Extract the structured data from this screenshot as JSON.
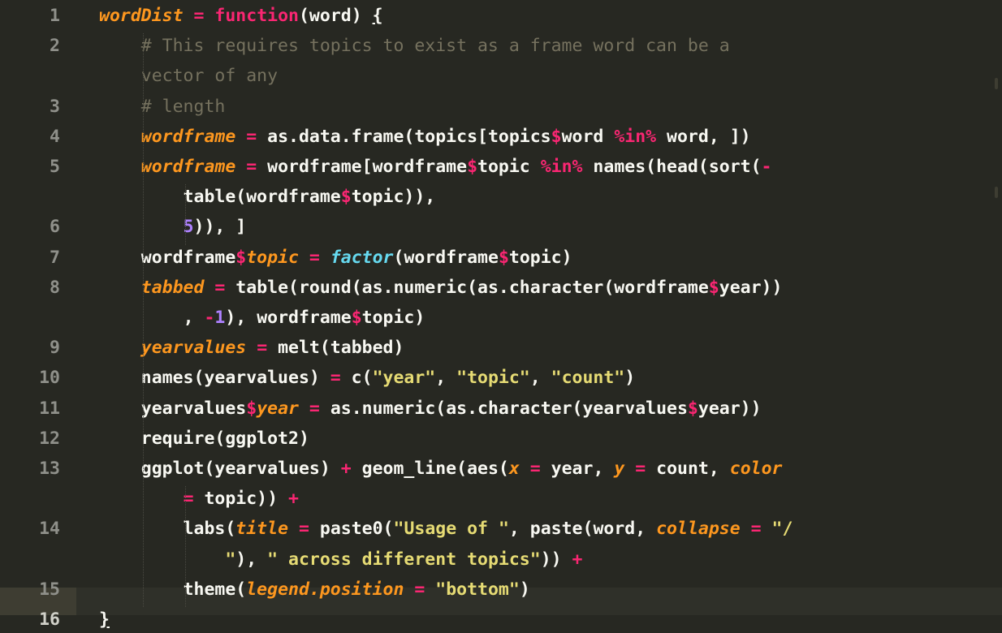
{
  "editor": {
    "theme_colors": {
      "background": "#272822",
      "foreground": "#f8f8f2",
      "keyword": "#f92672",
      "function": "#a6e22e",
      "variable": "#fd971f",
      "number": "#ae81ff",
      "string": "#e6db74",
      "comment": "#75715e",
      "support": "#66d9ef",
      "gutter_text": "#8f908a"
    },
    "line_numbers": [
      "1",
      "2",
      "3",
      "4",
      "5",
      "6",
      "7",
      "8",
      "9",
      "10",
      "11",
      "12",
      "13",
      "14",
      "15",
      "16"
    ],
    "active_line": "16",
    "lines": [
      {
        "row": 1,
        "indent": "",
        "tokens": [
          {
            "t": "var",
            "v": "wordDist"
          },
          {
            "t": "",
            "v": " "
          },
          {
            "t": "kw",
            "v": "="
          },
          {
            "t": "",
            "v": " "
          },
          {
            "t": "kw",
            "v": "function"
          },
          {
            "t": "",
            "v": "(word) "
          },
          {
            "t": "under",
            "v": "{"
          }
        ]
      },
      {
        "row": 2,
        "indent": "    ",
        "tokens": [
          {
            "t": "com",
            "v": "# This requires topics to exist as a frame word can be a"
          }
        ]
      },
      {
        "row": 3,
        "indent": "    ",
        "tokens": [
          {
            "t": "com",
            "v": "vector of any"
          }
        ]
      },
      {
        "row": 4,
        "indent": "    ",
        "tokens": [
          {
            "t": "com",
            "v": "# length"
          }
        ]
      },
      {
        "row": 5,
        "indent": "    ",
        "tokens": [
          {
            "t": "var",
            "v": "wordframe"
          },
          {
            "t": "",
            "v": " "
          },
          {
            "t": "kw",
            "v": "="
          },
          {
            "t": "",
            "v": " as.data.frame(topics[topics"
          },
          {
            "t": "kw",
            "v": "$"
          },
          {
            "t": "",
            "v": "word "
          },
          {
            "t": "kw",
            "v": "%in%"
          },
          {
            "t": "",
            "v": " word, ])"
          }
        ]
      },
      {
        "row": 6,
        "indent": "    ",
        "tokens": [
          {
            "t": "var",
            "v": "wordframe"
          },
          {
            "t": "",
            "v": " "
          },
          {
            "t": "kw",
            "v": "="
          },
          {
            "t": "",
            "v": " wordframe[wordframe"
          },
          {
            "t": "kw",
            "v": "$"
          },
          {
            "t": "",
            "v": "topic "
          },
          {
            "t": "kw",
            "v": "%in%"
          },
          {
            "t": "",
            "v": " names(head(sort("
          },
          {
            "t": "kw",
            "v": "-"
          }
        ]
      },
      {
        "row": 7,
        "indent": "        ",
        "tokens": [
          {
            "t": "",
            "v": "table(wordframe"
          },
          {
            "t": "kw",
            "v": "$"
          },
          {
            "t": "",
            "v": "topic)),"
          }
        ]
      },
      {
        "row": 8,
        "indent": "        ",
        "tokens": [
          {
            "t": "num",
            "v": "5"
          },
          {
            "t": "",
            "v": ")), ]"
          }
        ]
      },
      {
        "row": 9,
        "indent": "    ",
        "tokens": [
          {
            "t": "",
            "v": "wordframe"
          },
          {
            "t": "kw",
            "v": "$"
          },
          {
            "t": "var",
            "v": "topic"
          },
          {
            "t": "",
            "v": " "
          },
          {
            "t": "kw",
            "v": "="
          },
          {
            "t": "",
            "v": " "
          },
          {
            "t": "sup",
            "v": "factor"
          },
          {
            "t": "",
            "v": "(wordframe"
          },
          {
            "t": "kw",
            "v": "$"
          },
          {
            "t": "",
            "v": "topic)"
          }
        ]
      },
      {
        "row": 10,
        "indent": "    ",
        "tokens": [
          {
            "t": "var",
            "v": "tabbed"
          },
          {
            "t": "",
            "v": " "
          },
          {
            "t": "kw",
            "v": "="
          },
          {
            "t": "",
            "v": " table(round(as.numeric(as.character(wordframe"
          },
          {
            "t": "kw",
            "v": "$"
          },
          {
            "t": "",
            "v": "year))"
          }
        ]
      },
      {
        "row": 11,
        "indent": "        ",
        "tokens": [
          {
            "t": "",
            "v": ", "
          },
          {
            "t": "kw",
            "v": "-"
          },
          {
            "t": "num",
            "v": "1"
          },
          {
            "t": "",
            "v": "), wordframe"
          },
          {
            "t": "kw",
            "v": "$"
          },
          {
            "t": "",
            "v": "topic)"
          }
        ]
      },
      {
        "row": 12,
        "indent": "    ",
        "tokens": [
          {
            "t": "var",
            "v": "yearvalues"
          },
          {
            "t": "",
            "v": " "
          },
          {
            "t": "kw",
            "v": "="
          },
          {
            "t": "",
            "v": " melt(tabbed)"
          }
        ]
      },
      {
        "row": 13,
        "indent": "    ",
        "tokens": [
          {
            "t": "",
            "v": "names(yearvalues) "
          },
          {
            "t": "kw",
            "v": "="
          },
          {
            "t": "",
            "v": " c("
          },
          {
            "t": "str",
            "v": "\"year\""
          },
          {
            "t": "",
            "v": ", "
          },
          {
            "t": "str",
            "v": "\"topic\""
          },
          {
            "t": "",
            "v": ", "
          },
          {
            "t": "str",
            "v": "\"count\""
          },
          {
            "t": "",
            "v": ")"
          }
        ]
      },
      {
        "row": 14,
        "indent": "    ",
        "tokens": [
          {
            "t": "",
            "v": "yearvalues"
          },
          {
            "t": "kw",
            "v": "$"
          },
          {
            "t": "var",
            "v": "year"
          },
          {
            "t": "",
            "v": " "
          },
          {
            "t": "kw",
            "v": "="
          },
          {
            "t": "",
            "v": " as.numeric(as.character(yearvalues"
          },
          {
            "t": "kw",
            "v": "$"
          },
          {
            "t": "",
            "v": "year))"
          }
        ]
      },
      {
        "row": 15,
        "indent": "    ",
        "tokens": [
          {
            "t": "",
            "v": "require(ggplot2)"
          }
        ]
      },
      {
        "row": 16,
        "indent": "    ",
        "tokens": [
          {
            "t": "",
            "v": "ggplot(yearvalues) "
          },
          {
            "t": "kw",
            "v": "+"
          },
          {
            "t": "",
            "v": " geom_line(aes("
          },
          {
            "t": "var",
            "v": "x"
          },
          {
            "t": "",
            "v": " "
          },
          {
            "t": "kw",
            "v": "="
          },
          {
            "t": "",
            "v": " year, "
          },
          {
            "t": "var",
            "v": "y"
          },
          {
            "t": "",
            "v": " "
          },
          {
            "t": "kw",
            "v": "="
          },
          {
            "t": "",
            "v": " count, "
          },
          {
            "t": "var",
            "v": "color"
          }
        ]
      },
      {
        "row": 17,
        "indent": "        ",
        "tokens": [
          {
            "t": "kw",
            "v": "="
          },
          {
            "t": "",
            "v": " topic)) "
          },
          {
            "t": "kw",
            "v": "+"
          }
        ]
      },
      {
        "row": 18,
        "indent": "        ",
        "tokens": [
          {
            "t": "",
            "v": "labs("
          },
          {
            "t": "var",
            "v": "title"
          },
          {
            "t": "",
            "v": " "
          },
          {
            "t": "kw",
            "v": "="
          },
          {
            "t": "",
            "v": " paste0("
          },
          {
            "t": "str",
            "v": "\"Usage of \""
          },
          {
            "t": "",
            "v": ", paste(word, "
          },
          {
            "t": "var",
            "v": "collapse"
          },
          {
            "t": "",
            "v": " "
          },
          {
            "t": "kw",
            "v": "="
          },
          {
            "t": "",
            "v": " "
          },
          {
            "t": "str",
            "v": "\"/"
          }
        ]
      },
      {
        "row": 19,
        "indent": "            ",
        "tokens": [
          {
            "t": "str",
            "v": "\""
          },
          {
            "t": "",
            "v": "), "
          },
          {
            "t": "str",
            "v": "\" across different topics\""
          },
          {
            "t": "",
            "v": ")) "
          },
          {
            "t": "kw",
            "v": "+"
          }
        ]
      },
      {
        "row": 20,
        "indent": "        ",
        "tokens": [
          {
            "t": "",
            "v": "theme("
          },
          {
            "t": "var",
            "v": "legend.position"
          },
          {
            "t": "",
            "v": " "
          },
          {
            "t": "kw",
            "v": "="
          },
          {
            "t": "",
            "v": " "
          },
          {
            "t": "str",
            "v": "\"bottom\""
          },
          {
            "t": "",
            "v": ")"
          }
        ]
      },
      {
        "row": 21,
        "indent": "",
        "tokens": [
          {
            "t": "under",
            "v": "}"
          }
        ]
      }
    ],
    "gutter_rows": [
      {
        "num": "1",
        "row": 1
      },
      {
        "num": "2",
        "row": 2
      },
      {
        "num": "3",
        "row": 4
      },
      {
        "num": "4",
        "row": 5
      },
      {
        "num": "5",
        "row": 6
      },
      {
        "num": "6",
        "row": 8
      },
      {
        "num": "7",
        "row": 9
      },
      {
        "num": "8",
        "row": 10
      },
      {
        "num": "9",
        "row": 12
      },
      {
        "num": "10",
        "row": 13
      },
      {
        "num": "11",
        "row": 14
      },
      {
        "num": "12",
        "row": 15
      },
      {
        "num": "13",
        "row": 16
      },
      {
        "num": "14",
        "row": 18
      },
      {
        "num": "15",
        "row": 20
      },
      {
        "num": "16",
        "row": 21
      }
    ]
  }
}
